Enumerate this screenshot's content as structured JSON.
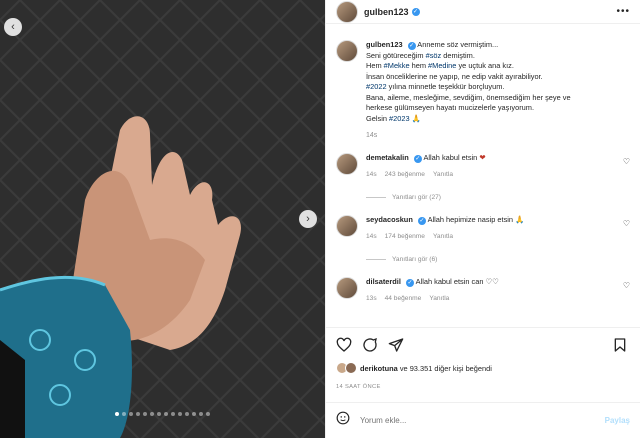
{
  "post": {
    "username": "gulben123",
    "menu_icon": "more-horizontal-icon"
  },
  "caption": {
    "username": "gulben123",
    "line1": "Annemе söz vermiştim...",
    "line2_a": "Seni götüreceğim ",
    "line2_tag": "#söz",
    "line2_b": " demiştim.",
    "line3_a": "Hem ",
    "line3_tag1": "#Mekke",
    "line3_b": " hem ",
    "line3_tag2": "#Medine",
    "line3_c": " ye uçtuk ana kız.",
    "line4": "İnsan önceliklerine ne yapıp, ne edip vakit ayırabiliyor.",
    "line5_tag": "#2022",
    "line5_b": " yılına minnetle teşekkür borçluyum.",
    "line6": "Bana, aileme, mesleğime, sevdiğim, önemsediğim her şeye ve",
    "line7": "herkese gülümseyen hayatı mucizelerle yaşıyorum.",
    "line8_a": "Gelsin ",
    "line8_tag": "#2023",
    "line8_emoji": "🙏",
    "time": "14s"
  },
  "comments": [
    {
      "username": "demetakalin",
      "text": "Allah kabul etsin",
      "emoji": "❤",
      "time": "14s",
      "likes": "243 beğenme",
      "reply": "Yanıtla",
      "replies": "Yanıtları gör (27)"
    },
    {
      "username": "seydacoskun",
      "text": "Allah hepimize nasip etsin",
      "emoji": "🙏",
      "time": "14s",
      "likes": "174 beğenme",
      "reply": "Yanıtla",
      "replies": "Yanıtları gör (6)"
    },
    {
      "username": "dilsaterdil",
      "text": "Allah kabul etsin can",
      "emoji": "♡♡",
      "time": "13s",
      "likes": "44 beğenme",
      "reply": "Yanıtla"
    }
  ],
  "likes": {
    "user": "derikotuna",
    "rest": " ve 93.351 diğer kişi beğendi"
  },
  "ago": "14 SAAT ÖNCE",
  "comment_input": {
    "placeholder": "Yorum ekle...",
    "post_label": "Paylaş"
  },
  "carousel": {
    "total": 14,
    "active": 0
  }
}
